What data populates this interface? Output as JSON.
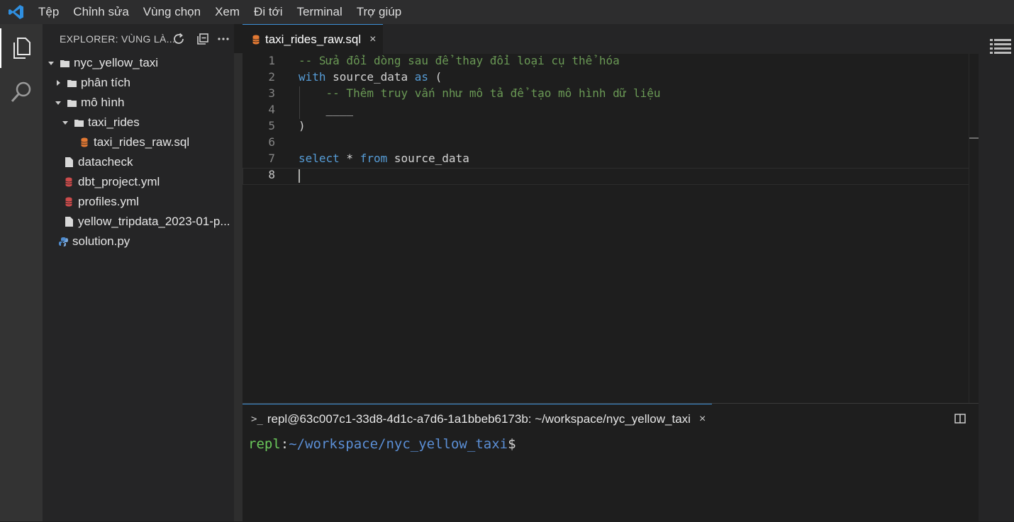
{
  "menubar": {
    "app_icon": "vscode-logo-icon",
    "items": [
      "Tệp",
      "Chỉnh sửa",
      "Vùng chọn",
      "Xem",
      "Đi tới",
      "Terminal",
      "Trợ giúp"
    ]
  },
  "activitybar": {
    "items": [
      {
        "icon": "explorer-icon",
        "active": true
      },
      {
        "icon": "search-icon",
        "active": false
      }
    ]
  },
  "sidebar": {
    "title": "EXPLORER: VÙNG LÀ...",
    "actions": [
      "refresh-icon",
      "collapse-all-icon",
      "more-icon"
    ],
    "tree": [
      {
        "label": "nyc_yellow_taxi",
        "type": "folder",
        "expanded": true,
        "depth": 0
      },
      {
        "label": "phân tích",
        "type": "folder",
        "expanded": false,
        "depth": 1
      },
      {
        "label": "mô hình",
        "type": "folder",
        "expanded": true,
        "depth": 1
      },
      {
        "label": "taxi_rides",
        "type": "folder",
        "expanded": true,
        "depth": 2
      },
      {
        "label": "taxi_rides_raw.sql",
        "type": "sql",
        "depth": 3
      },
      {
        "label": "datacheck",
        "type": "file",
        "depth": 1
      },
      {
        "label": "dbt_project.yml",
        "type": "yml",
        "depth": 1
      },
      {
        "label": "profiles.yml",
        "type": "yml",
        "depth": 1
      },
      {
        "label": "yellow_tripdata_2023-01-p...",
        "type": "file",
        "depth": 1
      },
      {
        "label": "solution.py",
        "type": "python",
        "depth": 0
      }
    ]
  },
  "editor": {
    "tab": {
      "label": "taxi_rides_raw.sql",
      "close": "×"
    },
    "line_numbers": [
      "1",
      "2",
      "3",
      "4",
      "5",
      "6",
      "7",
      "8"
    ],
    "lines": {
      "l1": "-- Sửa đổi dòng sau để thay đổi loại cụ thể hóa",
      "l2_kw1": "with",
      "l2_mid": " source_data ",
      "l2_kw2": "as",
      "l2_end": " (",
      "l3": "    -- Thêm truy vấn như mô tả để tạo mô hình dữ liệu",
      "l4": "    ____",
      "l5": ")",
      "l7_kw1": "select",
      "l7_mid": " * ",
      "l7_kw2": "from",
      "l7_end": " source_data"
    }
  },
  "terminal": {
    "tab_label": "repl@63c007c1-33d8-4d1c-a7d6-1a1bbeb6173b: ~/workspace/nyc_yellow_taxi",
    "prompt_symbol": ">_",
    "close": "×",
    "user": "repl",
    "colon": ":",
    "path": "~/workspace/nyc_yellow_taxi",
    "dollar": "$"
  },
  "colors": {
    "accent": "#3c8fd6",
    "comment": "#6a9955",
    "keyword": "#569cd6",
    "sql_icon": "#e37933",
    "yml_icon": "#cc4b4b",
    "python_icon": "#4f8ccf"
  }
}
